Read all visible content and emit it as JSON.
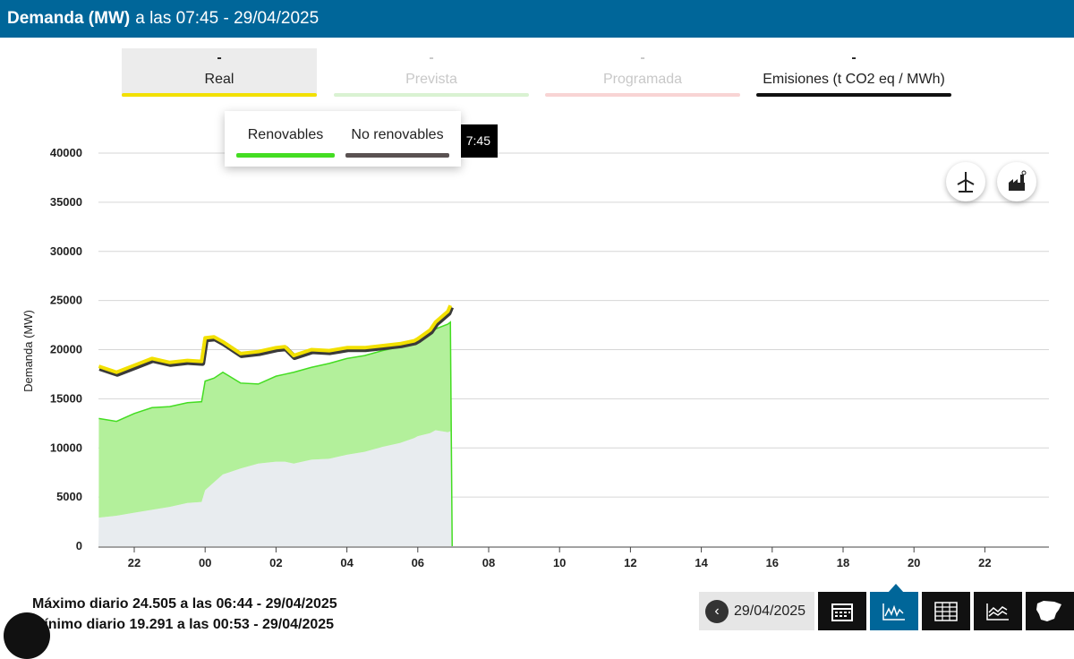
{
  "header": {
    "title_bold": "Demanda (MW)",
    "title_rest": "a las 07:45 - 29/04/2025"
  },
  "tabs": [
    {
      "value": "-",
      "label": "Real"
    },
    {
      "value": "-",
      "label": "Prevista"
    },
    {
      "value": "-",
      "label": "Programada"
    },
    {
      "value": "-",
      "label": "Emisiones (t CO2 eq / MWh)"
    }
  ],
  "tooltip": {
    "time": "7:45"
  },
  "popup": {
    "renovables": "Renovables",
    "no_renovables": "No renovables"
  },
  "icons": {
    "wind": "wind-turbine-icon",
    "factory": "factory-icon"
  },
  "stats": {
    "max": "Máximo diario 24.505 a las 06:44 - 29/04/2025",
    "min": "Mínimo diario 19.291 a las 00:53 - 29/04/2025"
  },
  "nav": {
    "date": "29/04/2025"
  },
  "colors": {
    "header": "#006699",
    "real": "#f2e000",
    "renovables": "#44dd22",
    "no_renovables": "#5a5252",
    "base_area": "#e8ecef"
  },
  "chart_data": {
    "type": "area",
    "ylabel": "Demanda (MW)",
    "ylim": [
      0,
      40000
    ],
    "yticks": [
      "0",
      "5000",
      "10000",
      "15000",
      "20000",
      "25000",
      "30000",
      "35000",
      "40000"
    ],
    "xticks": [
      "22",
      "00",
      "02",
      "04",
      "06",
      "08",
      "10",
      "12",
      "14",
      "16",
      "18",
      "20",
      "22"
    ],
    "x_hours": [
      21,
      21.5,
      22,
      22.5,
      23,
      23.5,
      23.9,
      24,
      24.25,
      24.5,
      25,
      25.5,
      26,
      26.25,
      26.5,
      27,
      27.5,
      28,
      28.5,
      29,
      29.5,
      29.9,
      30,
      30.35,
      30.5,
      30.85,
      30.92
    ],
    "series": [
      {
        "name": "Real",
        "values": [
          18300,
          17700,
          18400,
          19100,
          18700,
          18900,
          18800,
          21200,
          21300,
          20800,
          19600,
          19800,
          20200,
          20300,
          19400,
          20000,
          19900,
          20200,
          20200,
          20400,
          20600,
          20900,
          21100,
          22000,
          22800,
          23900,
          24500
        ]
      },
      {
        "name": "Renovables",
        "values": [
          13000,
          12700,
          13500,
          14100,
          14200,
          14600,
          14700,
          16800,
          17100,
          17700,
          16600,
          16500,
          17300,
          17500,
          17700,
          18200,
          18600,
          19100,
          19400,
          19900,
          20300,
          20600,
          21000,
          21600,
          22100,
          22600,
          22800
        ]
      },
      {
        "name": "No renovables",
        "values": [
          2900,
          3100,
          3400,
          3700,
          4000,
          4400,
          4500,
          5700,
          6500,
          7300,
          7900,
          8400,
          8600,
          8600,
          8400,
          8800,
          8900,
          9300,
          9600,
          10100,
          10500,
          11000,
          11200,
          11500,
          11800,
          11600,
          11700
        ]
      }
    ]
  }
}
